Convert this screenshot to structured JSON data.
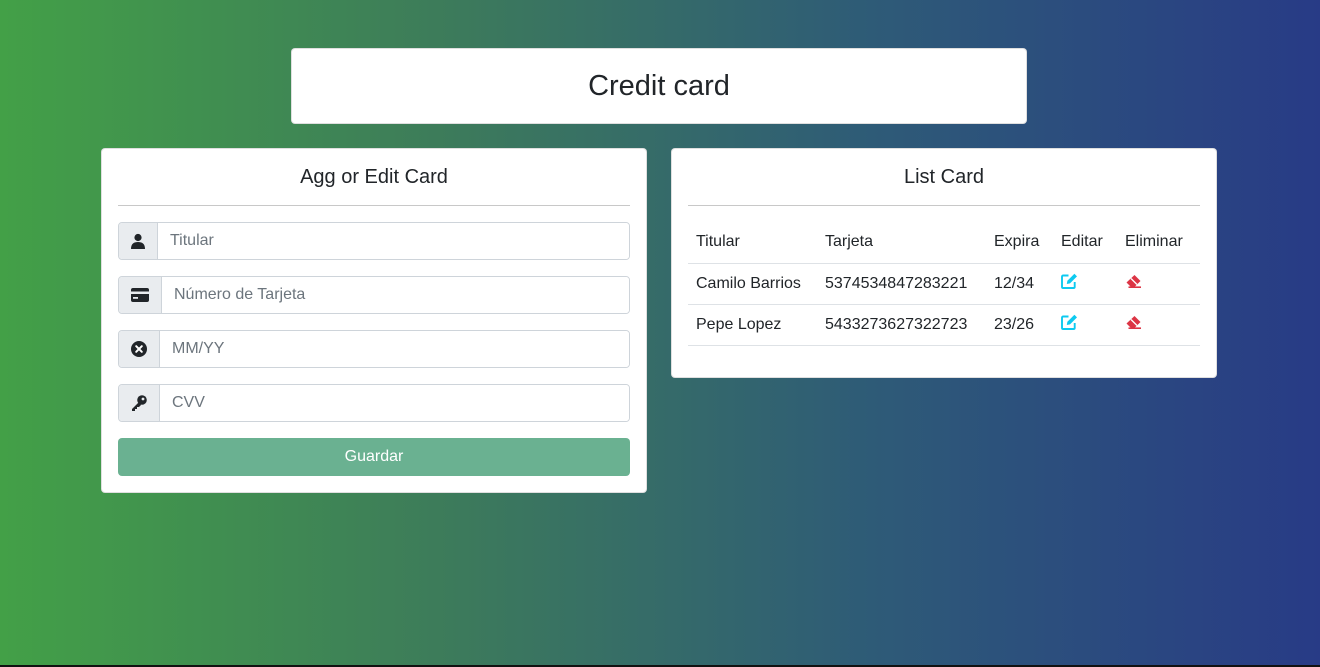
{
  "header": {
    "title": "Credit card"
  },
  "form": {
    "title": "Agg or Edit Card",
    "fields": [
      {
        "icon": "user-icon",
        "placeholder": "Titular",
        "value": ""
      },
      {
        "icon": "credit-card-icon",
        "placeholder": "Número de Tarjeta",
        "value": ""
      },
      {
        "icon": "times-circle-icon",
        "placeholder": "MM/YY",
        "value": ""
      },
      {
        "icon": "key-icon",
        "placeholder": "CVV",
        "value": ""
      }
    ],
    "save_label": "Guardar"
  },
  "list": {
    "title": "List Card",
    "columns": [
      "Titular",
      "Tarjeta",
      "Expira",
      "Editar",
      "Eliminar"
    ],
    "rows": [
      {
        "titular": "Camilo Barrios",
        "tarjeta": "5374534847283221",
        "expira": "12/34"
      },
      {
        "titular": "Pepe Lopez",
        "tarjeta": "5433273627322723",
        "expira": "23/26"
      }
    ]
  },
  "colors": {
    "edit_icon": "#0dcaf0",
    "delete_icon": "#dc3545",
    "save_button": "#6ab191"
  }
}
